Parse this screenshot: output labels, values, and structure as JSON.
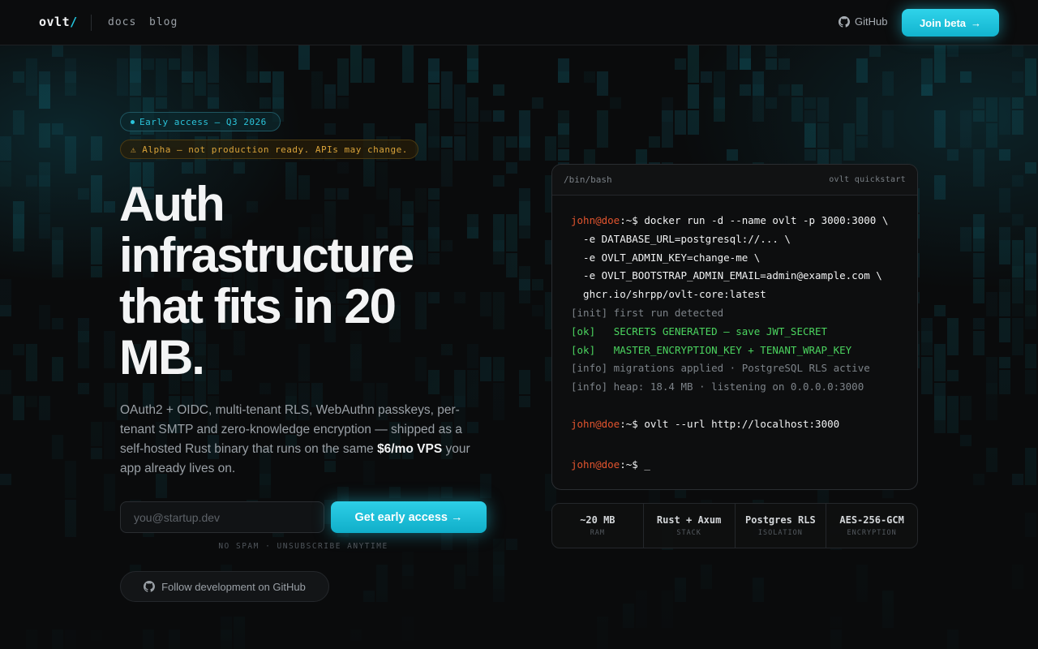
{
  "header": {
    "logo_text": "ovlt",
    "logo_slash": "/",
    "nav": [
      {
        "label": "docs"
      },
      {
        "label": "blog"
      }
    ],
    "github_label": "GitHub",
    "join_label": "Join beta",
    "join_arrow": "→"
  },
  "hero": {
    "early_pill": "Early access — Q3 2026",
    "alpha_pill": "⚠ Alpha — not production ready. APIs may change.",
    "title": "Auth infrastructure that fits in 20 MB.",
    "desc_before": "OAuth2 + OIDC, multi-tenant RLS, WebAuthn passkeys, per-tenant SMTP and zero-knowledge encryption — shipped as a self-hosted Rust binary that runs on the same ",
    "desc_strong": "$6/mo VPS",
    "desc_after": " your app already lives on.",
    "email_placeholder": "you@startup.dev",
    "cta_label": "Get early access →",
    "nospam": "NO SPAM · UNSUBSCRIBE ANYTIME",
    "follow_label": "Follow development on GitHub"
  },
  "terminal": {
    "title_left": "/bin/bash",
    "title_right": "ovlt quickstart",
    "user": "john@doe",
    "prompt_suffix": ":~$ ",
    "cmd1": "docker run -d --name ovlt -p 3000:3000 \\",
    "cmd1_l2": "  -e DATABASE_URL=postgresql://... \\",
    "cmd1_l3": "  -e OVLT_ADMIN_KEY=change-me \\",
    "cmd1_l4": "  -e OVLT_BOOTSTRAP_ADMIN_EMAIL=admin@example.com \\",
    "cmd1_l5": "  ghcr.io/shrpp/ovlt-core:latest",
    "out1": "[init] first run detected",
    "out2_tag": "[ok]   ",
    "out2_text": "SECRETS GENERATED — save JWT_SECRET",
    "out3_tag": "[ok]   ",
    "out3_text": "MASTER_ENCRYPTION_KEY + TENANT_WRAP_KEY",
    "out4": "[info] migrations applied · PostgreSQL RLS active",
    "out5": "[info] heap: 18.4 MB · listening on 0.0.0.0:3000",
    "cmd2": "ovlt --url http://localhost:3000",
    "cursor": "_"
  },
  "stats": [
    {
      "value": "~20 MB",
      "label": "RAM"
    },
    {
      "value": "Rust + Axum",
      "label": "STACK"
    },
    {
      "value": "Postgres RLS",
      "label": "ISOLATION"
    },
    {
      "value": "AES-256-GCM",
      "label": "ENCRYPTION"
    }
  ],
  "colors": {
    "accent": "#22c7e0",
    "user_prompt": "#e2542e",
    "ok_green": "#4bd45f",
    "alpha_amber": "#d9a33a"
  }
}
